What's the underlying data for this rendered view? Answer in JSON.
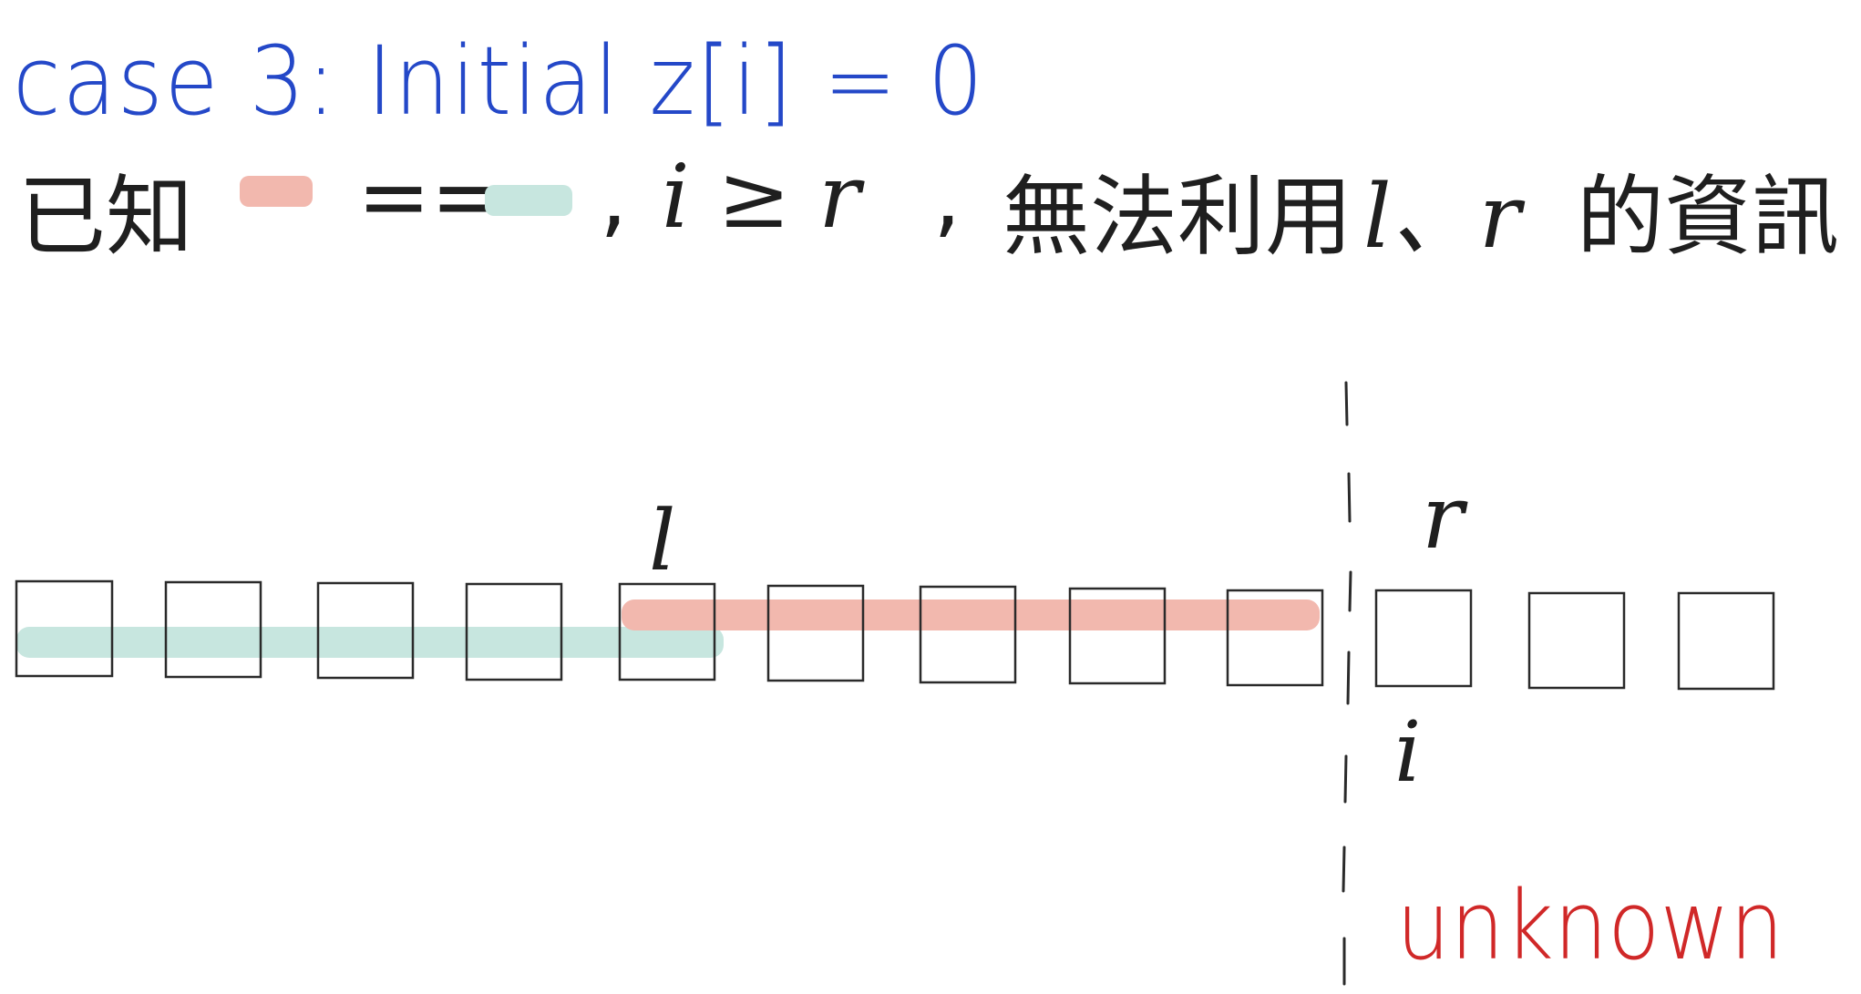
{
  "title": "case 3:  Initial z[i] = 0",
  "known": {
    "prefix": "已知",
    "equals": "==",
    "comma1": ",",
    "condition": "i ≥ r",
    "comma2": ",",
    "conclusion": "無法利用",
    "vars": "l、r",
    "suffix": "的資訊"
  },
  "labels": {
    "l": "l",
    "r": "r",
    "i": "i",
    "unknown": "unknown"
  },
  "colors": {
    "red_band": "#f2b8ae",
    "teal_band": "#c7e6df",
    "title": "#2448c8",
    "unknown": "#d02828"
  },
  "cells": {
    "count": 12
  }
}
